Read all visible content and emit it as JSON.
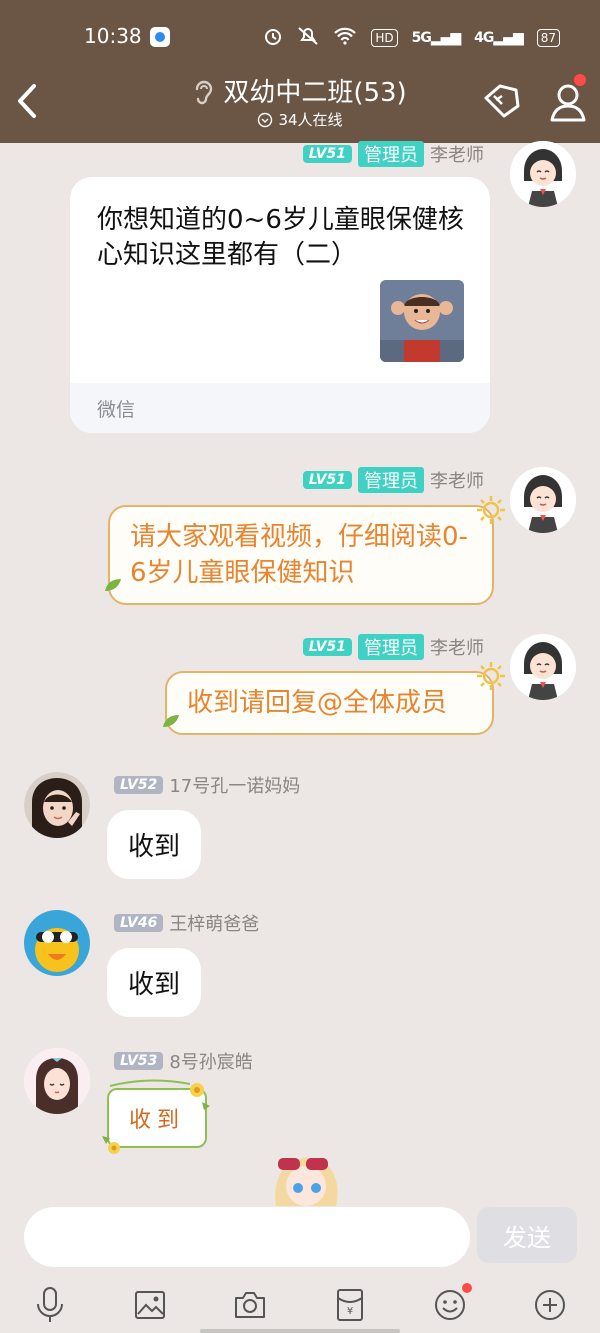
{
  "status_bar": {
    "time": "10:38",
    "signal_1": "5G",
    "signal_2": "4G",
    "battery": "87"
  },
  "header": {
    "title": "双幼中二班(53)",
    "online": "34人在线"
  },
  "messages": [
    {
      "level": "LV51",
      "role": "管理员",
      "sender": "李老师",
      "card_title": "你想知道的0~6岁儿童眼保健核心知识这里都有（二）",
      "card_source": "微信"
    },
    {
      "level": "LV51",
      "role": "管理员",
      "sender": "李老师",
      "text": "请大家观看视频，仔细阅读0-6岁儿童眼保健知识"
    },
    {
      "level": "LV51",
      "role": "管理员",
      "sender": "李老师",
      "text": "收到请回复@全体成员"
    },
    {
      "level": "LV52",
      "sender": "17号孔一诺妈妈",
      "text": "收到"
    },
    {
      "level": "LV46",
      "sender": "王梓萌爸爸",
      "text": "收到"
    },
    {
      "level": "LV53",
      "sender": "8号孙宸皓",
      "text": "收到"
    }
  ],
  "composer": {
    "send_label": "发送"
  },
  "colors": {
    "header_bg": "#6b5646",
    "admin_badge": "#3fd2c4",
    "orange_text": "#e8842f",
    "notify_dot": "#ff4a4a"
  }
}
